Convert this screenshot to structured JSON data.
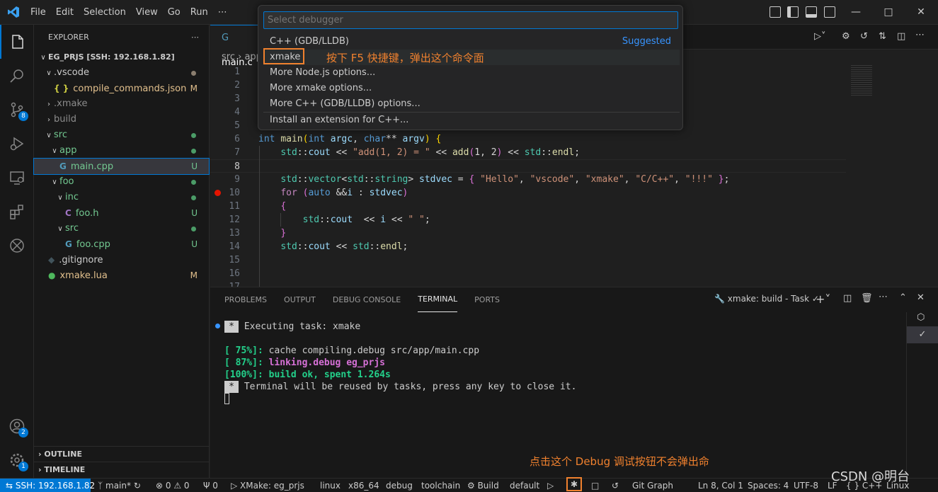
{
  "menu": [
    "File",
    "Edit",
    "Selection",
    "View",
    "Go",
    "Run",
    "⋯"
  ],
  "sidebar": {
    "title": "EXPLORER",
    "more": "⋯",
    "tree": [
      {
        "label": "EG_PRJS [SSH: 192.168.1.82]",
        "indent": 0,
        "chev": "∨",
        "bold": true,
        "color": "#cccccc"
      },
      {
        "label": ".vscode",
        "indent": 1,
        "chev": "∨",
        "color": "#cccccc",
        "dot": "#8b7e6f"
      },
      {
        "label": "compile_commands.json",
        "indent": 2,
        "icon": "{ }",
        "iconColor": "#cbcb41",
        "color": "#e2c08d",
        "status": "M",
        "statusColor": "#e2c08d"
      },
      {
        "label": ".xmake",
        "indent": 1,
        "chev": "›",
        "color": "#8c8c8c"
      },
      {
        "label": "build",
        "indent": 1,
        "chev": "›",
        "color": "#8c8c8c"
      },
      {
        "label": "src",
        "indent": 1,
        "chev": "∨",
        "color": "#73c991",
        "dot": "#4b9c67"
      },
      {
        "label": "app",
        "indent": 2,
        "chev": "∨",
        "color": "#73c991",
        "dot": "#4b9c67"
      },
      {
        "label": "main.cpp",
        "indent": 3,
        "icon": "G",
        "iconColor": "#519aba",
        "color": "#73c991",
        "status": "U",
        "statusColor": "#73c991",
        "selected": true
      },
      {
        "label": "foo",
        "indent": 2,
        "chev": "∨",
        "color": "#73c991",
        "dot": "#4b9c67"
      },
      {
        "label": "inc",
        "indent": 3,
        "chev": "∨",
        "color": "#73c991",
        "dot": "#4b9c67"
      },
      {
        "label": "foo.h",
        "indent": 4,
        "icon": "C",
        "iconColor": "#a074c4",
        "color": "#73c991",
        "status": "U",
        "statusColor": "#73c991"
      },
      {
        "label": "src",
        "indent": 3,
        "chev": "∨",
        "color": "#73c991",
        "dot": "#4b9c67"
      },
      {
        "label": "foo.cpp",
        "indent": 4,
        "icon": "G",
        "iconColor": "#519aba",
        "color": "#73c991",
        "status": "U",
        "statusColor": "#73c991"
      },
      {
        "label": ".gitignore",
        "indent": 1,
        "icon": "◆",
        "iconColor": "#41535b",
        "color": "#cccccc"
      },
      {
        "label": "xmake.lua",
        "indent": 1,
        "icon": "●",
        "iconColor": "#4eb85d",
        "color": "#e2c08d",
        "status": "M",
        "statusColor": "#e2c08d"
      }
    ],
    "outline": "OUTLINE",
    "timeline": "TIMELINE"
  },
  "activity_badges": {
    "scm": "8",
    "accounts": "2",
    "settings": "1"
  },
  "editor": {
    "tab": "main.c",
    "breadcrumb": "src › app",
    "lines": [
      "1",
      "2",
      "3",
      "4",
      "5",
      "6",
      "7",
      "8",
      "9",
      "10",
      "11",
      "12",
      "13",
      "14",
      "15",
      "16",
      "17"
    ]
  },
  "quickpick": {
    "placeholder": "Select debugger",
    "items": [
      {
        "label": "C++ (GDB/LLDB)",
        "tag": "Suggested"
      },
      {
        "label": "xmake"
      },
      {
        "label": "More Node.js options..."
      },
      {
        "label": "More xmake options..."
      },
      {
        "label": "More C++ (GDB/LLDB) options..."
      },
      {
        "label": "Install an extension for C++..."
      }
    ]
  },
  "panel": {
    "tabs": [
      "PROBLEMS",
      "OUTPUT",
      "DEBUG CONSOLE",
      "TERMINAL",
      "PORTS"
    ],
    "task": "xmake: build - Task",
    "terminal": [
      {
        "text": " Executing task: xmake",
        "star": true,
        "color": "#cccccc"
      },
      {
        "text": "",
        "color": "#cccccc"
      },
      {
        "text": "[ 75%]: cache compiling.debug src/app/main.cpp",
        "color": "#cccccc",
        "prefix": "[ 75%]:",
        "prefixColor": "#23d18b"
      },
      {
        "text": "[ 87%]: linking.debug eg_prjs",
        "color": "#d670d6",
        "bold": true,
        "prefix": "[ 87%]:",
        "prefixColor": "#23d18b"
      },
      {
        "text": "[100%]: build ok, spent 1.264s",
        "color": "#23d18b",
        "bold": true
      },
      {
        "text": " Terminal will be reused by tasks, press any key to close it.",
        "star": true,
        "color": "#cccccc"
      }
    ]
  },
  "statusbar": {
    "remote": "SSH: 192.168.1.82",
    "branch": "main*",
    "errors": "⊗ 0 ⚠ 0",
    "ports": "0",
    "xmake": "XMake: eg_prjs",
    "os": "linux",
    "arch": "x86_64",
    "mode": "debug",
    "toolchain": "toolchain",
    "build": "Build",
    "target": "default",
    "gitgraph": "Git Graph",
    "position": "Ln 8, Col 1",
    "spaces": "Spaces: 4",
    "encoding": "UTF-8",
    "eol": "LF",
    "lang": "{ } C++",
    "platform": "Linux"
  },
  "annotations": {
    "top": "按下 F5 快捷键，弹出这个命令面",
    "bottom": "点击这个 Debug 调试按钮不会弹出命",
    "watermark": "CSDN @明台"
  }
}
